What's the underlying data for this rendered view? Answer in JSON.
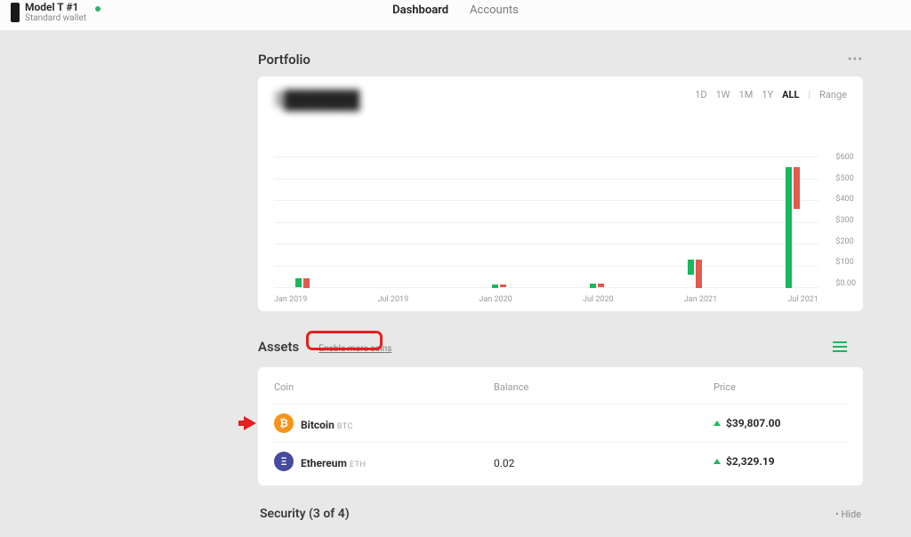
{
  "header": {
    "device_name": "Model T #1",
    "device_sub": "Standard wallet",
    "nav": {
      "dashboard": "Dashboard",
      "accounts": "Accounts"
    }
  },
  "portfolio": {
    "title": "Portfolio",
    "amount_prefix": "$",
    "ranges": {
      "d1": "1D",
      "w1": "1W",
      "m1": "1M",
      "y1": "1Y",
      "all": "ALL",
      "range": "Range"
    }
  },
  "chart_data": {
    "type": "bar",
    "categories": [
      "Jan 2019",
      "Jul 2019",
      "Jan 2020",
      "Jul 2020",
      "Jan 2021",
      "Jul 2021"
    ],
    "series": [
      {
        "name": "green",
        "values": [
          40,
          0,
          18,
          22,
          70,
          550
        ]
      },
      {
        "name": "red",
        "values": [
          45,
          0,
          15,
          18,
          130,
          190
        ]
      }
    ],
    "title": "Portfolio",
    "xlabel": "",
    "ylabel": "",
    "ylim": [
      0,
      600
    ],
    "yticks": [
      "$600",
      "$500",
      "$400",
      "$300",
      "$200",
      "$100",
      "$0.00"
    ]
  },
  "assets": {
    "title": "Assets",
    "enable_more": "Enable more coins",
    "columns": {
      "coin": "Coin",
      "balance": "Balance",
      "price": "Price"
    },
    "rows": [
      {
        "name": "Bitcoin",
        "ticker": "BTC",
        "icon_bg": "#f7931a",
        "icon_glyph": "₿",
        "balance_prefix": "",
        "price": "$39,807.00"
      },
      {
        "name": "Ethereum",
        "ticker": "ETH",
        "icon_bg": "#454a9e",
        "icon_glyph": "Ξ",
        "balance_prefix": "0.02",
        "price": "$2,329.19"
      }
    ]
  },
  "security": {
    "title": "Security (3 of 4)",
    "hide": "• Hide"
  }
}
